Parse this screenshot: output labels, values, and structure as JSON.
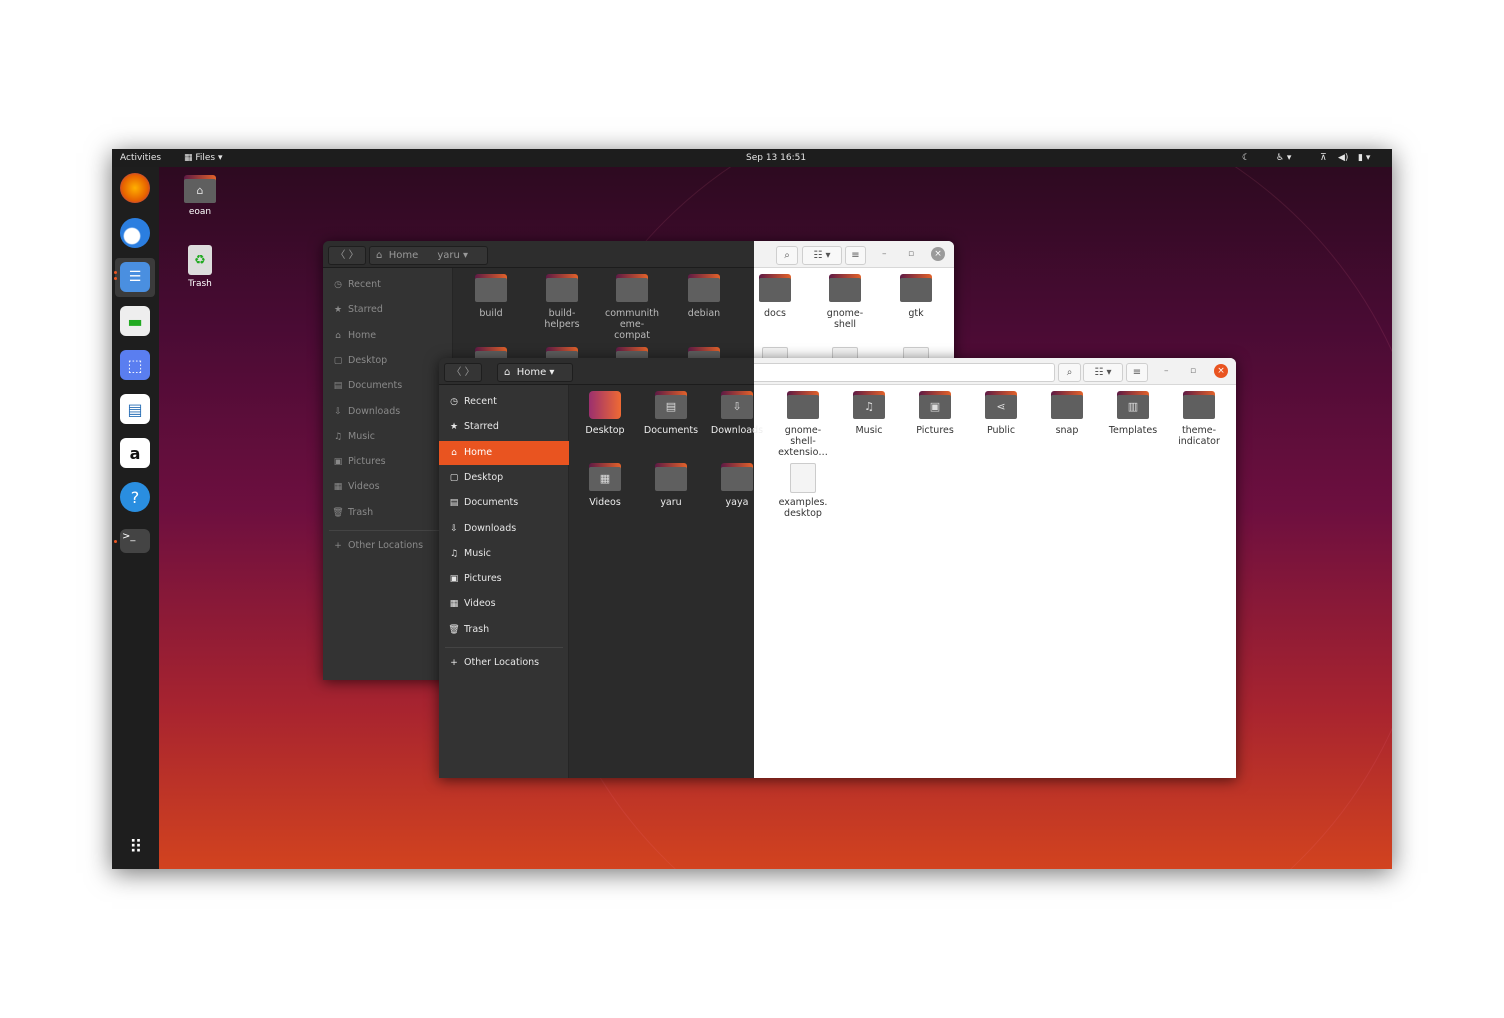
{
  "topbar": {
    "activities": "Activities",
    "app_menu": "Files",
    "clock": "Sep 13  16:51"
  },
  "dock": {
    "items": [
      "firefox",
      "thunderbird",
      "files",
      "settings",
      "screenshot",
      "libreoffice-writer",
      "amazon",
      "help",
      "terminal"
    ],
    "apps_grid": "show-applications"
  },
  "desktop": [
    {
      "label": "eoan",
      "icon": "home-folder-icon"
    },
    {
      "label": "Trash",
      "icon": "trash-icon"
    }
  ],
  "back_window": {
    "path": [
      "Home",
      "yaru"
    ],
    "sidebar": [
      "Recent",
      "Starred",
      "Home",
      "Desktop",
      "Documents",
      "Downloads",
      "Music",
      "Pictures",
      "Videos",
      "Trash"
    ],
    "other_locations": "Other Locations",
    "items": [
      "build",
      "build-\nhelpers",
      "communith\neme-\ncompat",
      "debian",
      "docs",
      "gnome-\nshell",
      "gtk"
    ]
  },
  "front_window": {
    "path": [
      "Home"
    ],
    "selected": "Home",
    "sidebar": [
      "Recent",
      "Starred",
      "Home",
      "Desktop",
      "Documents",
      "Downloads",
      "Music",
      "Pictures",
      "Videos",
      "Trash"
    ],
    "other_locations": "Other Locations",
    "items": [
      {
        "label": "Desktop",
        "type": "desktop"
      },
      {
        "label": "Documents",
        "glyph": "▤"
      },
      {
        "label": "Downloads",
        "glyph": "⇩"
      },
      {
        "label": "gnome-\nshell-\nextensio…"
      },
      {
        "label": "Music",
        "glyph": "♫"
      },
      {
        "label": "Pictures",
        "glyph": "▣"
      },
      {
        "label": "Public",
        "glyph": "⋖"
      },
      {
        "label": "snap"
      },
      {
        "label": "Templates",
        "glyph": "▥"
      },
      {
        "label": "theme-\nindicator"
      },
      {
        "label": "Videos",
        "glyph": "▦"
      },
      {
        "label": "yaru"
      },
      {
        "label": "yaya"
      },
      {
        "label": "examples.\ndesktop",
        "type": "file"
      }
    ]
  },
  "colors": {
    "accent": "#e95420",
    "dark_bg": "#2b2b2b",
    "sidebar": "#333333"
  }
}
